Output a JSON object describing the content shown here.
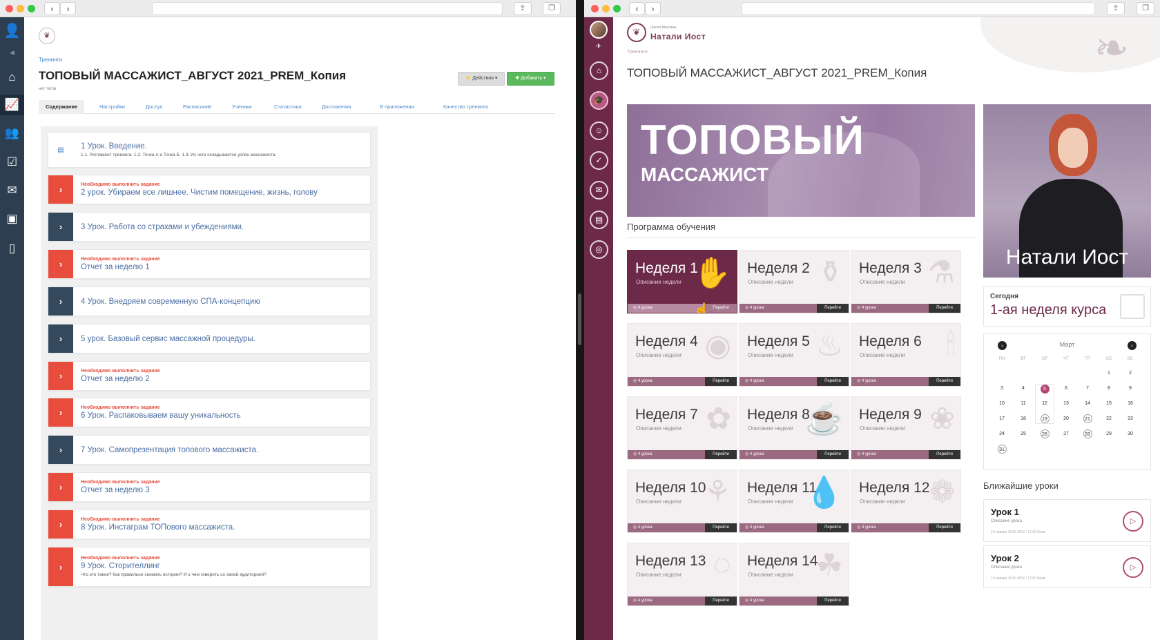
{
  "left": {
    "breadcrumb": "Тренинги",
    "title": "ТОПОВЫЙ МАССАЖИСТ_АВГУСТ 2021_PREM_Копия",
    "subtitle": "нет тегов",
    "actions_label": "⚡ Действия ▾",
    "add_label": "✚ Добавить ▾",
    "tabs": [
      {
        "label": "Содержание"
      },
      {
        "label": "Настройки"
      },
      {
        "label": "Доступ"
      },
      {
        "label": "Расписание"
      },
      {
        "label": "Ученики"
      },
      {
        "label": "Статистика"
      },
      {
        "label": "Достижения"
      },
      {
        "label": "В приложении"
      },
      {
        "label": "Качество тренинга"
      }
    ],
    "lessons": [
      {
        "type": "intro",
        "req": "",
        "title": "1 Урок. Введение.",
        "desc": "1.1. Регламент тренинга. 1.2. Точка А и Точка Б. 1.3. Из чего складывается успех массажиста."
      },
      {
        "type": "task",
        "req": "Необходимо выполнить задание",
        "title": "2 урок. Убираем все лишнее. Чистим помещение, жизнь, голову",
        "desc": ""
      },
      {
        "type": "lesson",
        "req": "",
        "title": "3 Урок. Работа со страхами и убеждениями.",
        "desc": ""
      },
      {
        "type": "task",
        "req": "Необходимо выполнить задание",
        "title": "Отчет за неделю 1",
        "desc": ""
      },
      {
        "type": "lesson",
        "req": "",
        "title": "4 Урок. Внедряем современную СПА-концепцию",
        "desc": ""
      },
      {
        "type": "lesson",
        "req": "",
        "title": "5 урок. Базовый сервис массажной процедуры.",
        "desc": ""
      },
      {
        "type": "task",
        "req": "Необходимо выполнить задание",
        "title": "Отчет за неделю 2",
        "desc": ""
      },
      {
        "type": "task",
        "req": "Необходимо выполнить задание",
        "title": "6 Урок. Распаковываем вашу уникальность",
        "desc": ""
      },
      {
        "type": "lesson",
        "req": "",
        "title": "7 Урок. Самопрезентация топового массажиста.",
        "desc": ""
      },
      {
        "type": "task",
        "req": "Необходимо выполнить задание",
        "title": "Отчет за неделю 3",
        "desc": ""
      },
      {
        "type": "task",
        "req": "Необходимо выполнить задание",
        "title": "8 Урок. Инстаграм ТОПового массажиста.",
        "desc": ""
      },
      {
        "type": "task",
        "req": "Необходимо выполнить задание",
        "title": "9 Урок. Сторителлинг",
        "desc": "Что это такое? Как правильно снимать истории? И о чем говорить со своей аудиторией?"
      }
    ]
  },
  "right": {
    "logo_sub": "Школа Массажа",
    "logo_name": "Натали Иост",
    "breadcrumb": "Тренинги",
    "title": "ТОПОВЫЙ МАССАЖИСТ_АВГУСТ 2021_PREM_Копия",
    "banner": {
      "line1": "ТОПОВЫЙ",
      "line2": "МАССАЖИСТ"
    },
    "portrait_name": "Натали Иост",
    "program_label": "Программа обучения",
    "weeks": [
      {
        "name": "Неделя 1",
        "desc": "Описание недели",
        "lessons": "◎ 4 урока",
        "go": "Перейти"
      },
      {
        "name": "Неделя 2",
        "desc": "Описание недели",
        "lessons": "◎ 4 урока",
        "go": "Перейти"
      },
      {
        "name": "Неделя 3",
        "desc": "Описание недели",
        "lessons": "◎ 4 урока",
        "go": "Перейти"
      },
      {
        "name": "Неделя 4",
        "desc": "Описание недели",
        "lessons": "◎ 4 урока",
        "go": "Перейти"
      },
      {
        "name": "Неделя 5",
        "desc": "Описание недели",
        "lessons": "◎ 4 урока",
        "go": "Перейти"
      },
      {
        "name": "Неделя 6",
        "desc": "Описание недели",
        "lessons": "◎ 4 урока",
        "go": "Перейти"
      },
      {
        "name": "Неделя 7",
        "desc": "Описание недели",
        "lessons": "◎ 4 урока",
        "go": "Перейти"
      },
      {
        "name": "Неделя 8",
        "desc": "Описание недели",
        "lessons": "◎ 4 урока",
        "go": "Перейти"
      },
      {
        "name": "Неделя 9",
        "desc": "Описание недели",
        "lessons": "◎ 4 урока",
        "go": "Перейти"
      },
      {
        "name": "Неделя 10",
        "desc": "Описание недели",
        "lessons": "◎ 4 урока",
        "go": "Перейти"
      },
      {
        "name": "Неделя 11",
        "desc": "Описание недели",
        "lessons": "◎ 4 урока",
        "go": "Перейти"
      },
      {
        "name": "Неделя 12",
        "desc": "Описание недели",
        "lessons": "◎ 4 урока",
        "go": "Перейти"
      },
      {
        "name": "Неделя 13",
        "desc": "Описание недели",
        "lessons": "◎ 4 урока",
        "go": "Перейти"
      },
      {
        "name": "Неделя 14",
        "desc": "Описание недели",
        "lessons": "◎ 4 урока",
        "go": "Перейти"
      }
    ],
    "today": {
      "label": "Сегодня",
      "value": "1-ая неделя курса"
    },
    "calendar": {
      "month": "Март",
      "day_headers": [
        "ПН",
        "ВТ",
        "СР",
        "ЧТ",
        "ПТ",
        "СБ",
        "ВС"
      ],
      "weeks": [
        [
          "",
          "",
          "",
          "",
          "",
          "1",
          "2"
        ],
        [
          "3",
          "4",
          "5",
          "6",
          "7",
          "8",
          "9"
        ],
        [
          "10",
          "11",
          "12",
          "13",
          "14",
          "15",
          "16"
        ],
        [
          "17",
          "18",
          "19",
          "20",
          "21",
          "22",
          "23"
        ],
        [
          "24",
          "25",
          "26",
          "27",
          "28",
          "29",
          "30"
        ],
        [
          "31",
          "",
          "",
          "",
          "",
          "",
          ""
        ]
      ],
      "today": "5",
      "events": [
        "19",
        "21",
        "26",
        "28",
        "31"
      ]
    },
    "near_label": "Ближайшие уроки",
    "near_lessons": [
      {
        "name": "Урок 1",
        "desc": "Описание урока",
        "meta": "10 января          18:00 МСК / 17:00 Киев"
      },
      {
        "name": "Урок 2",
        "desc": "Описание урока",
        "meta": "10 января          18:00 МСК / 17:00 Киев"
      }
    ]
  }
}
